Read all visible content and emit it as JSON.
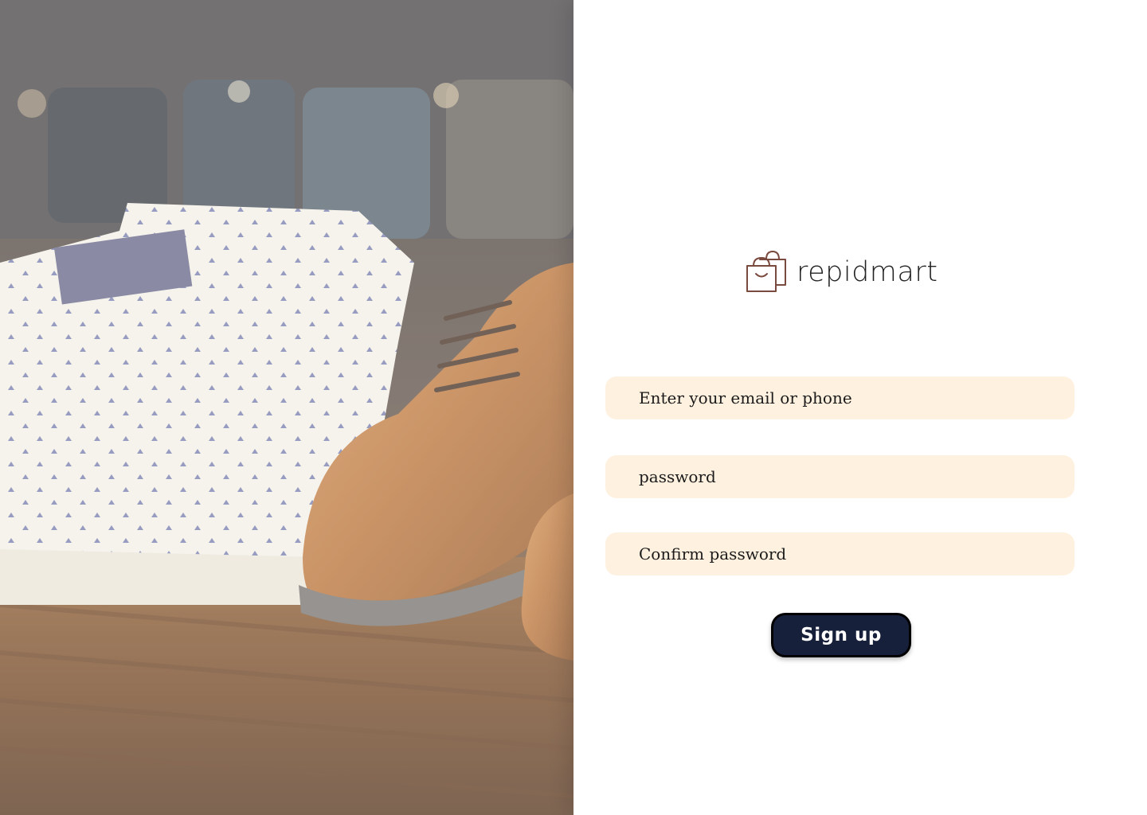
{
  "hero": {
    "image_description_icon": "clothing-and-shoes-photo"
  },
  "brand": {
    "name": "repidmart",
    "icon": "shopping-bags-icon",
    "icon_color": "#7a4a3e"
  },
  "form": {
    "email_placeholder": "Enter your email or phone",
    "password_placeholder": "password",
    "confirm_placeholder": "Confirm password",
    "submit_label": "Sign up"
  },
  "colors": {
    "field_bg": "#fff1df",
    "button_bg": "#17203a",
    "button_text": "#ffffff"
  }
}
